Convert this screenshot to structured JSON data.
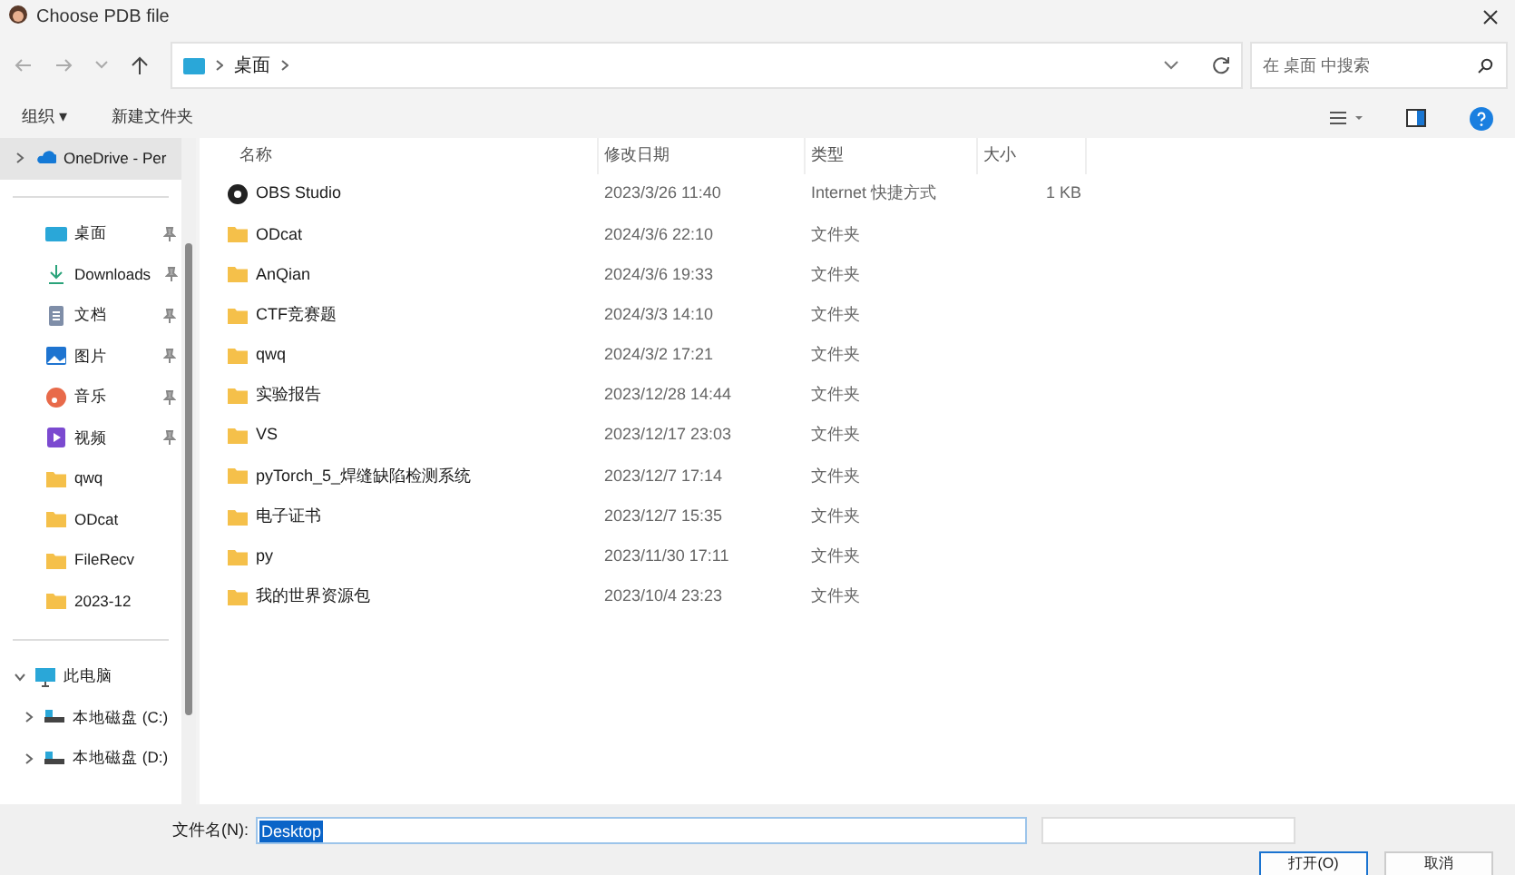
{
  "window": {
    "title": "Choose PDB file"
  },
  "address": {
    "crumbs": [
      "桌面"
    ]
  },
  "search": {
    "placeholder": "在 桌面 中搜索"
  },
  "toolbar": {
    "buttons": [
      "组织 ▾",
      "新建文件夹"
    ]
  },
  "sidebar": {
    "items": [
      {
        "label": "OneDrive - Per",
        "kind": "cloud",
        "selected": true,
        "pinned": false,
        "expanded": false
      },
      {
        "label": "桌面",
        "kind": "desktop",
        "selected": false,
        "pinned": true
      },
      {
        "label": "Downloads",
        "kind": "download",
        "selected": false,
        "pinned": true
      },
      {
        "label": "文档",
        "kind": "document",
        "selected": false,
        "pinned": true
      },
      {
        "label": "图片",
        "kind": "picture",
        "selected": false,
        "pinned": true
      },
      {
        "label": "音乐",
        "kind": "music",
        "selected": false,
        "pinned": true
      },
      {
        "label": "视频",
        "kind": "video",
        "selected": false,
        "pinned": true
      },
      {
        "label": "qwq",
        "kind": "folder",
        "selected": false,
        "pinned": false
      },
      {
        "label": "ODcat",
        "kind": "folder",
        "selected": false,
        "pinned": false
      },
      {
        "label": "FileRecv",
        "kind": "folder",
        "selected": false,
        "pinned": false
      },
      {
        "label": "2023-12",
        "kind": "folder",
        "selected": false,
        "pinned": false
      },
      {
        "label": "此电脑",
        "kind": "computer",
        "selected": false,
        "pinned": false,
        "expanded": true
      },
      {
        "label": "本地磁盘 (C:)",
        "kind": "drive",
        "selected": false,
        "pinned": false,
        "expanded": false
      },
      {
        "label": "本地磁盘 (D:)",
        "kind": "drive",
        "selected": false,
        "pinned": false,
        "expanded": false
      }
    ]
  },
  "table": {
    "columns": [
      "名称",
      "修改日期",
      "类型",
      "大小"
    ],
    "rows": [
      {
        "name": "OBS Studio",
        "kind": "shortcut",
        "date": "2023/3/26 11:40",
        "type": "Internet 快捷方式",
        "size": "1 KB"
      },
      {
        "name": "ODcat",
        "kind": "folder",
        "date": "2024/3/6 22:10",
        "type": "文件夹"
      },
      {
        "name": "AnQian",
        "kind": "folder",
        "date": "2024/3/6 19:33",
        "type": "文件夹"
      },
      {
        "name": "CTF竞赛题",
        "kind": "folder",
        "date": "2024/3/3 14:10",
        "type": "文件夹"
      },
      {
        "name": "qwq",
        "kind": "folder",
        "date": "2024/3/2 17:21",
        "type": "文件夹"
      },
      {
        "name": "实验报告",
        "kind": "folder",
        "date": "2023/12/28 14:44",
        "type": "文件夹"
      },
      {
        "name": "VS",
        "kind": "folder",
        "date": "2023/12/17 23:03",
        "type": "文件夹"
      },
      {
        "name": "pyTorch_5_焊缝缺陷检测系统",
        "kind": "folder",
        "date": "2023/12/7 17:14",
        "type": "文件夹"
      },
      {
        "name": "电子证书",
        "kind": "folder",
        "date": "2023/12/7 15:35",
        "type": "文件夹"
      },
      {
        "name": "py",
        "kind": "folder",
        "date": "2023/11/30 17:11",
        "type": "文件夹"
      },
      {
        "name": "我的世界资源包",
        "kind": "folder",
        "date": "2023/10/4 23:23",
        "type": "文件夹"
      }
    ]
  },
  "footer": {
    "filename_label": "文件名(N):",
    "filename": "Desktop",
    "buttons": [
      "打开(O)",
      "取消"
    ]
  }
}
